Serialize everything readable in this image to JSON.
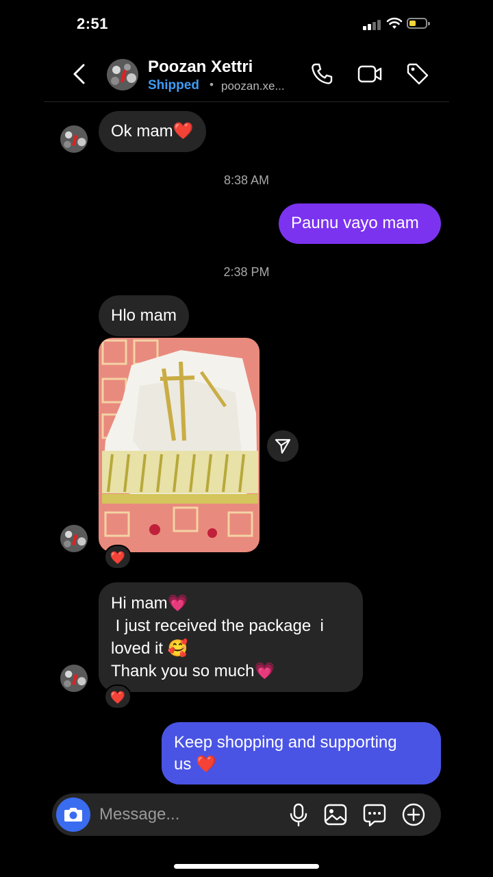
{
  "status_bar": {
    "time": "2:51"
  },
  "header": {
    "name": "Poozan Xettri",
    "status": "Shipped",
    "separator": "•",
    "handle": "poozan.xe..."
  },
  "messages": {
    "m1": {
      "text": "Ok mam",
      "emoji": "❤️"
    },
    "ts1": "8:38 AM",
    "m2": {
      "text": "Paunu vayo mam"
    },
    "ts2": "2:38 PM",
    "m3": {
      "text": "Hlo mam"
    },
    "photo_reaction": "❤️",
    "m4": {
      "line1": "Hi mam",
      "line1_emoji": "💗",
      "line2": " I just received the package  i",
      "line3": "loved it ",
      "line3_emoji": "🥰",
      "line4": "Thank you so much",
      "line4_emoji": "💗"
    },
    "m4_reaction": "❤️",
    "m5": {
      "line1": "Keep shopping and supporting",
      "line2": "us ",
      "emoji": "❤️"
    }
  },
  "composer": {
    "placeholder": "Message..."
  },
  "colors": {
    "background": "#000000",
    "received_bubble": "#262626",
    "sent_purple": "#7b33f0",
    "sent_blue": "#4a54e4",
    "shipped_label": "#3f9cf5",
    "camera_button": "#3a6cf0"
  }
}
